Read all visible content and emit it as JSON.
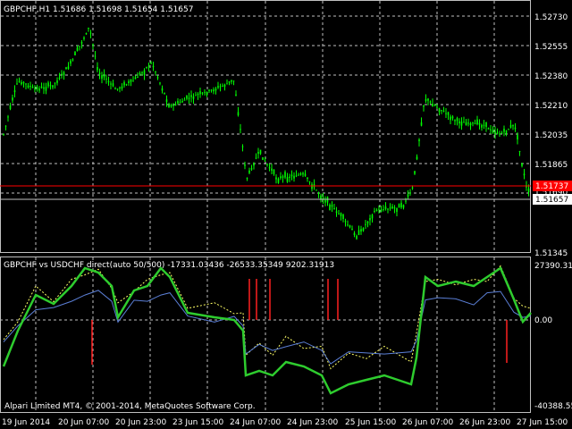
{
  "main_panel": {
    "header": "GBPCHF,H1  1.51686 1.51698 1.51654 1.51657",
    "price_ticks": [
      "1.52730",
      "1.52555",
      "1.52380",
      "1.52210",
      "1.52035",
      "1.51865",
      "1.51690",
      "1.51345"
    ],
    "ask_marker": "1.51737",
    "bid_marker": "1.51657",
    "colors": {
      "bullish": "#00ff00",
      "bearish": "#00ff00",
      "grid": "#c0c0c0",
      "ask_line": "#ff0000",
      "bid_line": "#c0c0c0",
      "ask_marker_bg": "#ff0000",
      "bid_marker_bg": "#ffffff"
    }
  },
  "indicator_panel": {
    "header": "GBPCHF vs USDCHF direct(auto 50/500) -17331.03436 -26533.35349 9202.31913",
    "ticks": [
      "27390.31",
      "0.00",
      "-40388.55"
    ],
    "watermark": "Alpari Limited MT4, © 2001-2014, MetaQuotes Software Corp.",
    "colors": {
      "main": "#2ecc2e",
      "blue": "#5b7fd6",
      "yellow": "#ffff66",
      "bars": "#ff2020"
    }
  },
  "time_axis": [
    "19 Jun 2014",
    "20 Jun 07:00",
    "20 Jun 23:00",
    "23 Jun 15:00",
    "24 Jun 07:00",
    "24 Jun 23:00",
    "25 Jun 15:00",
    "26 Jun 07:00",
    "26 Jun 23:00",
    "27 Jun 15:00"
  ]
}
